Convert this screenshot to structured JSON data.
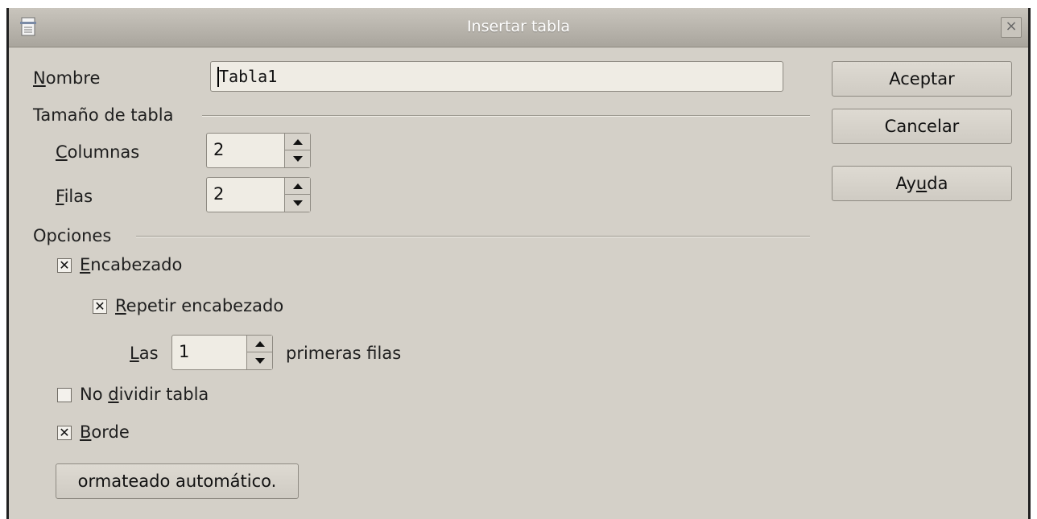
{
  "dialog": {
    "title": "Insertar tabla",
    "title_icon": "document-icon",
    "close_glyph": "×"
  },
  "name_field": {
    "label_accel": "N",
    "label_rest": "ombre",
    "value": "Tabla1"
  },
  "table_size": {
    "heading": "Tamaño de tabla",
    "columns": {
      "label_accel": "C",
      "label_rest": "olumnas",
      "value": "2"
    },
    "rows": {
      "label_accel": "F",
      "label_rest": "ilas",
      "value": "2"
    }
  },
  "options": {
    "heading": "Opciones",
    "heading_checkbox": {
      "label_accel": "E",
      "label_rest": "ncabezado",
      "checked": true,
      "mark": "✕"
    },
    "repeat_heading": {
      "label_accel": "R",
      "label_rest": "epetir encabezado",
      "checked": true,
      "mark": "✕"
    },
    "first_rows": {
      "prefix_accel": "L",
      "prefix_rest": "as",
      "value": "1",
      "suffix": "primeras filas"
    },
    "no_split": {
      "label_before": "No ",
      "label_accel": "d",
      "label_after": "ividir tabla",
      "checked": false,
      "mark": ""
    },
    "border": {
      "label_accel": "B",
      "label_rest": "orde",
      "checked": true,
      "mark": "✕"
    },
    "autoformat_button": "ormateado automático."
  },
  "buttons": {
    "ok": "Aceptar",
    "cancel": "Cancelar",
    "help_before": "Ay",
    "help_accel": "u",
    "help_after": "da"
  }
}
